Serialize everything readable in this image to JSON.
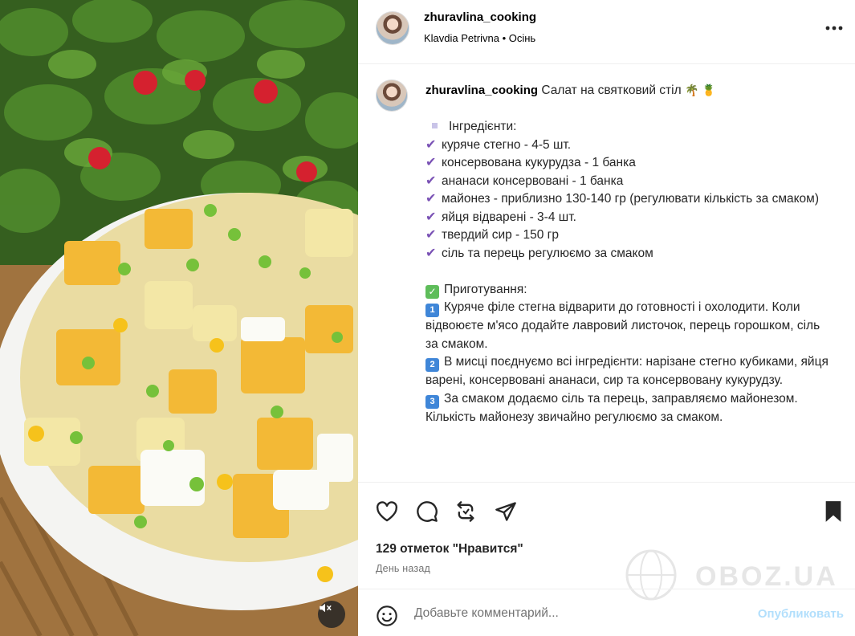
{
  "header": {
    "username": "zhuravlina_cooking",
    "author": "Klavdia Petrivna",
    "separator": " • ",
    "audio": "Осінь"
  },
  "caption": {
    "username": "zhuravlina_cooking",
    "title": "Салат на святковий стіл",
    "title_emojis": "🌴 🍍",
    "ingredients_heading": "Інгредієнти:",
    "ingredients": [
      "куряче стегно - 4-5 шт.",
      "консервована кукурудза - 1 банка",
      "ананаси консервовані - 1 банка",
      "майонез - приблизно 130-140 гр (регулювати кількість за смаком)",
      "яйця відварені - 3-4 шт.",
      "твердий сир - 150 гр",
      "сіль та перець регулюємо за смаком"
    ],
    "preparation_heading": "Приготування:",
    "steps": [
      {
        "num": "1",
        "text": "Куряче філе стегна відварити до готовності і охолодити. Коли відвоюєте м'ясо додайте лавровий листочок, перець горошком, сіль за смаком."
      },
      {
        "num": "2",
        "text": "В мисці поєднуємо всі інгредієнти: нарізане стегно кубиками, яйця варені, консервовані ананаси, сир та консервовану кукурудзу."
      },
      {
        "num": "3",
        "text": "За смаком додаємо сіль та перець, заправляємо майонезом. Кількість майонезу звичайно регулюємо за смаком."
      }
    ]
  },
  "actions": {
    "icons": [
      "heart-icon",
      "comment-icon",
      "repost-icon",
      "share-icon",
      "bookmark-icon"
    ],
    "likes": "129 отметок \"Нравится\"",
    "time": "День назад"
  },
  "watermark": "OBOZ.UA",
  "comment_box": {
    "placeholder": "Добавьте комментарий...",
    "post_label": "Опубликовать"
  },
  "colors": {
    "post_button": "#b2dffc",
    "checkmark": "#7a52b5",
    "keycap": "#3f86d8",
    "check_box": "#5ebd5a"
  }
}
